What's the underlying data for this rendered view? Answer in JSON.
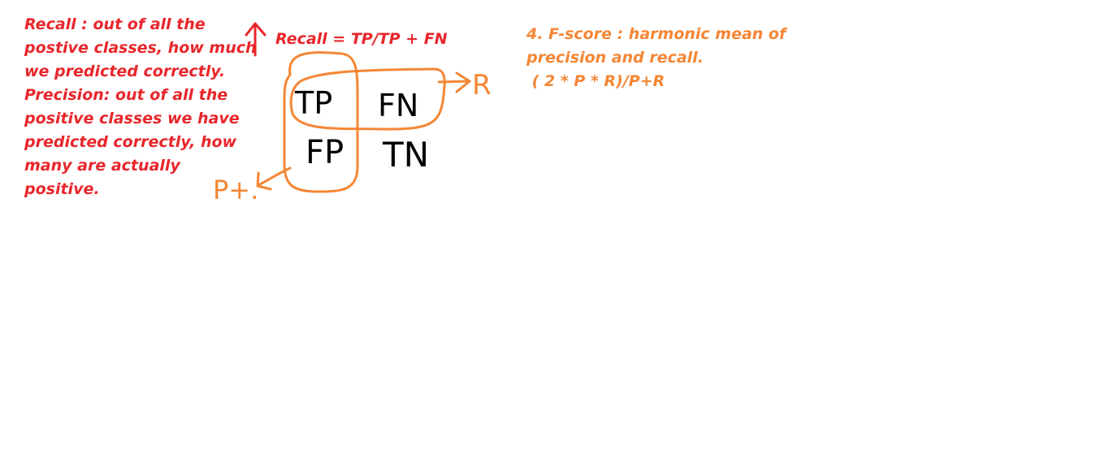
{
  "notes": {
    "definitions": "Recall : out of all the\npostive classes, how much\nwe predicted correctly.\nPrecision: out of all the\npositive classes we have\npredicted correctly, how\nmany are actually\npositive.",
    "recall_formula": "Recall = TP/TP + FN",
    "fscore": "4. F-score : harmonic mean of\nprecision and recall.\n ( 2 * P * R)/P+R"
  },
  "matrix": {
    "tp": "TP",
    "fn": "FN",
    "fp": "FP",
    "tn": "TN"
  },
  "arrows": {
    "recall_label": "R",
    "precision_label": "P+."
  },
  "colors": {
    "red": "#e8262b",
    "orange": "#f58634",
    "ink": "#000000"
  }
}
